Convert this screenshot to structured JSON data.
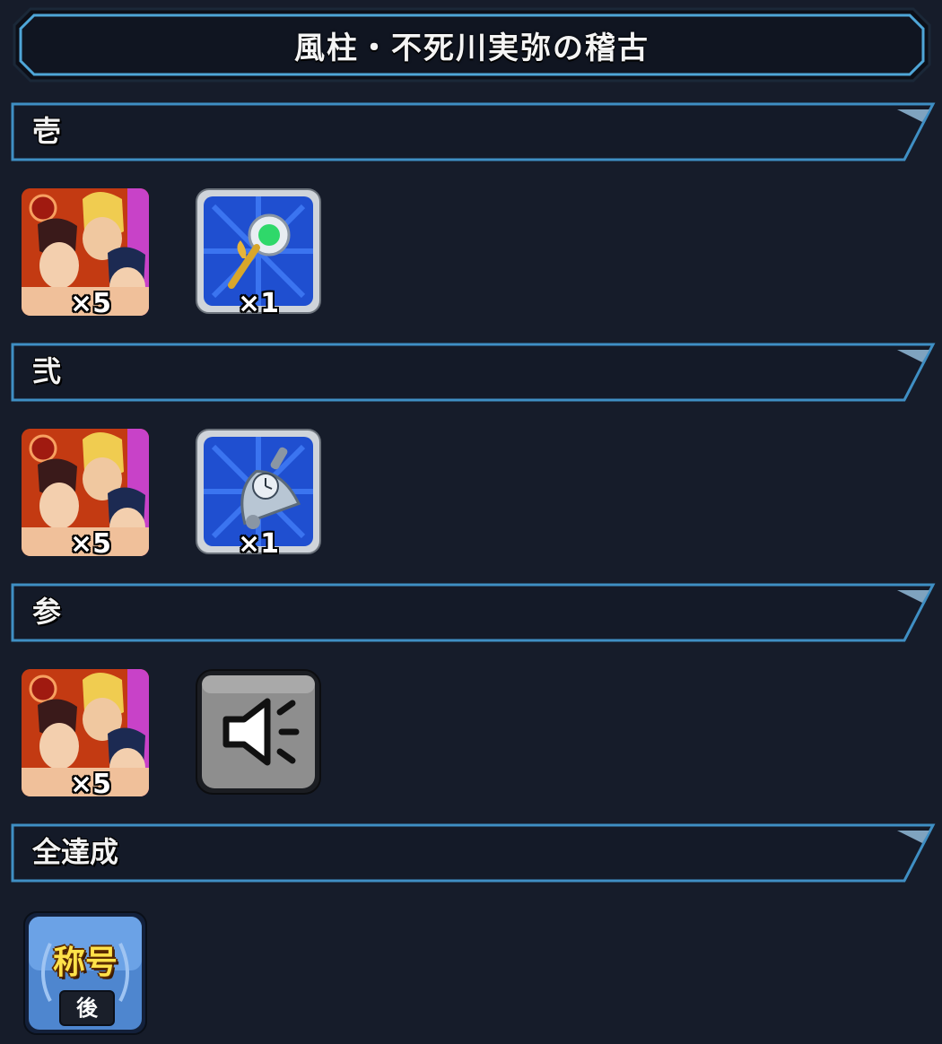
{
  "header": {
    "title": "風柱・不死川実弥の稽古"
  },
  "sections": [
    {
      "label": "壱",
      "rewards": [
        {
          "type": "character",
          "icon": "character-group-icon",
          "count": "×5"
        },
        {
          "type": "item",
          "icon": "golden-key-icon",
          "count": "×1"
        }
      ]
    },
    {
      "label": "弐",
      "rewards": [
        {
          "type": "character",
          "icon": "character-group-icon",
          "count": "×5"
        },
        {
          "type": "item",
          "icon": "bell-clock-icon",
          "count": "×1"
        }
      ]
    },
    {
      "label": "参",
      "rewards": [
        {
          "type": "character",
          "icon": "character-group-icon",
          "count": "×5"
        },
        {
          "type": "item",
          "icon": "voice-speaker-icon"
        }
      ]
    },
    {
      "label": "全達成",
      "rewards": [
        {
          "type": "title",
          "icon": "title-badge-icon",
          "badge_text": "称号",
          "badge_sub": "後"
        }
      ]
    }
  ],
  "colors": {
    "background": "#161c2a",
    "accent_border": "#4fa6d8",
    "item_bg": "#1f4fd0",
    "char_bg": "#c33a12"
  }
}
